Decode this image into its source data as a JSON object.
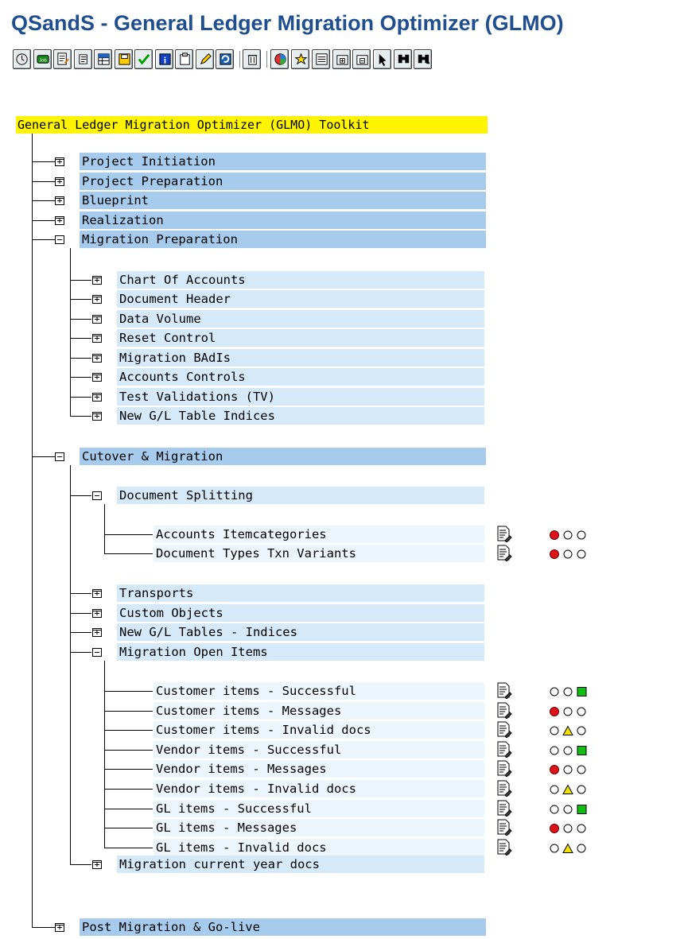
{
  "window": {
    "title": "QSandS - General Ledger Migration Optimizer (GLMO)"
  },
  "toolbar": {
    "buttons": [
      {
        "icon": "clock-icon"
      },
      {
        "icon": "job-icon"
      },
      {
        "icon": "document-edit-icon"
      },
      {
        "icon": "scroll-icon"
      },
      {
        "icon": "table-icon"
      },
      {
        "icon": "save-icon"
      },
      {
        "icon": "check-icon"
      },
      {
        "icon": "info-icon"
      },
      {
        "icon": "clipboard-icon"
      },
      {
        "icon": "pencil-icon"
      },
      {
        "icon": "refresh-icon"
      },
      {
        "icon": "trash-icon"
      },
      {
        "icon": "color-wheel-icon"
      },
      {
        "icon": "star-icon"
      },
      {
        "icon": "list-icon"
      },
      {
        "icon": "expand-icon"
      },
      {
        "icon": "collapse-icon"
      },
      {
        "icon": "pointer-icon"
      },
      {
        "icon": "find-icon"
      },
      {
        "icon": "find-next-icon"
      }
    ]
  },
  "tree": {
    "root_label": "General Ledger Migration Optimizer (GLMO) Toolkit",
    "level1": [
      "Project Initiation",
      "Project Preparation",
      "Blueprint",
      "Realization",
      "Migration Preparation"
    ],
    "migration_preparation": [
      "Chart Of Accounts",
      "Document Header",
      "Data Volume",
      "Reset Control",
      "Migration BAdIs",
      "Accounts Controls",
      "Test Validations (TV)",
      "New G/L Table Indices"
    ],
    "cutover": "Cutover & Migration",
    "document_splitting": "Document Splitting",
    "document_splitting_items": [
      {
        "label": "Accounts Itemcategories",
        "status": "red"
      },
      {
        "label": "Document Types Txn Variants",
        "status": "red"
      }
    ],
    "cutover_children": [
      "Transports",
      "Custom Objects",
      "New G/L Tables - Indices",
      "Migration Open Items"
    ],
    "open_items": [
      {
        "label": "Customer items - Successful",
        "status": "green"
      },
      {
        "label": "Customer items - Messages",
        "status": "red"
      },
      {
        "label": "Customer items - Invalid docs",
        "status": "yellow"
      },
      {
        "label": "Vendor items - Successful",
        "status": "green"
      },
      {
        "label": "Vendor items - Messages",
        "status": "red"
      },
      {
        "label": "Vendor items - Invalid docs",
        "status": "yellow"
      },
      {
        "label": "GL items - Successful",
        "status": "green"
      },
      {
        "label": "GL items - Messages",
        "status": "red"
      },
      {
        "label": "GL items - Invalid docs",
        "status": "yellow"
      }
    ],
    "current_year": "Migration current year docs",
    "post_migration": "Post Migration & Go-live"
  },
  "colors": {
    "title": "#1f4f8f",
    "header_bg": "#fff400",
    "row_dark": "#a6cbec",
    "row_light": "#d6e9f8",
    "status_red": "#e0101a",
    "status_yellow": "#f2e000",
    "status_green": "#10c010"
  }
}
